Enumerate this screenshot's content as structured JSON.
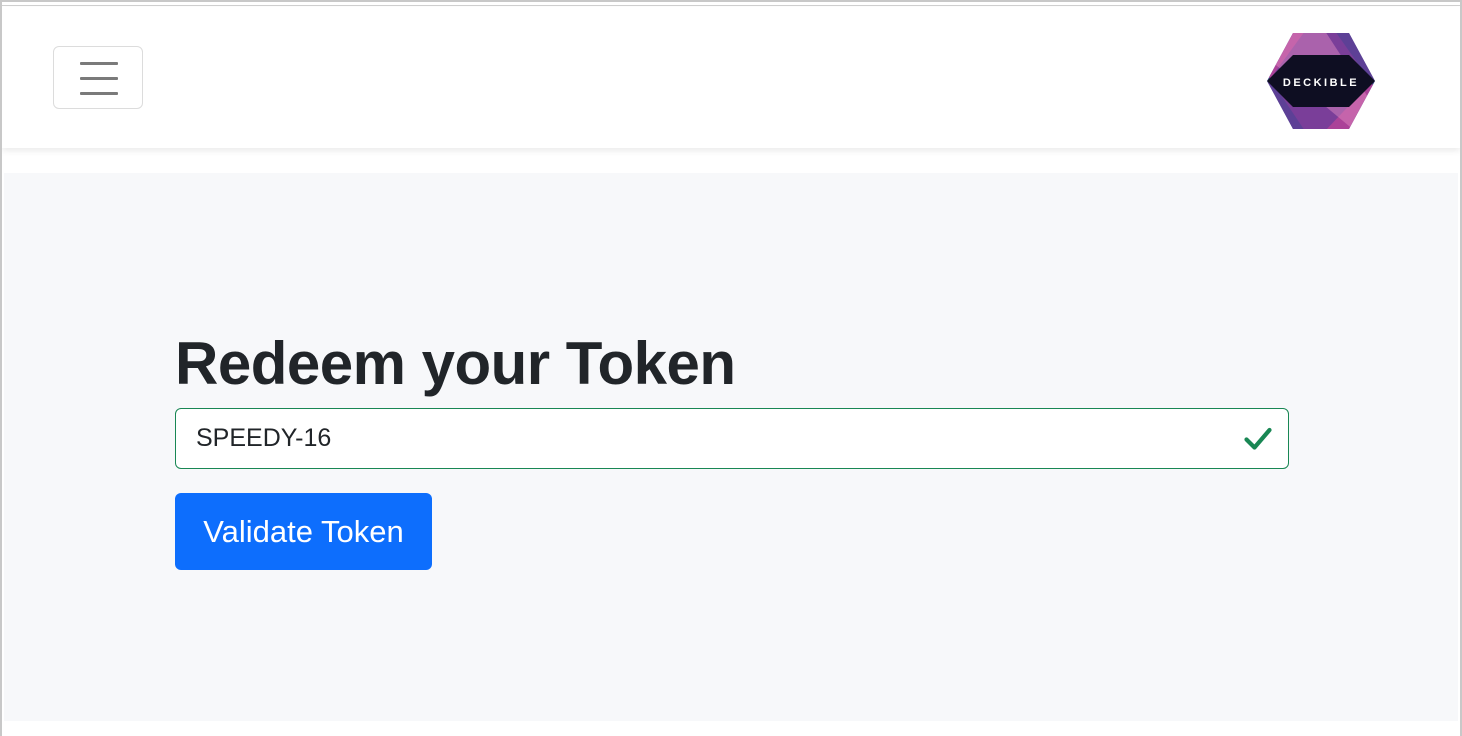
{
  "navbar": {
    "toggler_icon": "hamburger-icon",
    "logo": {
      "text": "DECKIBLE",
      "colors": [
        "#d63b94",
        "#6a3d9a",
        "#3b4a8c",
        "#0e0e22"
      ]
    }
  },
  "main": {
    "title": "Redeem your Token",
    "token_input": {
      "value": "SPEEDY-16",
      "valid": true,
      "border_color": "#198754",
      "status_icon": "checkmark-icon"
    },
    "validate_button": {
      "label": "Validate Token",
      "color": "#0d6efd"
    },
    "background": "#f7f8fa"
  }
}
